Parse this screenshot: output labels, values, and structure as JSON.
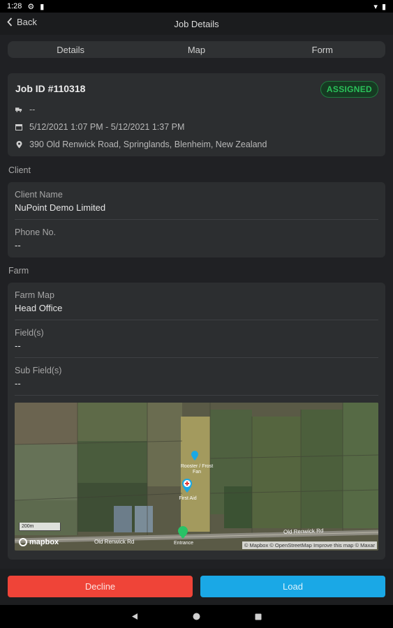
{
  "status_bar": {
    "time": "1:28"
  },
  "header": {
    "back_label": "Back",
    "title": "Job Details"
  },
  "tabs": [
    {
      "label": "Details"
    },
    {
      "label": "Map"
    },
    {
      "label": "Form"
    }
  ],
  "job": {
    "title": "Job ID #110318",
    "status": "ASSIGNED",
    "vehicle": "--",
    "datetime": "5/12/2021 1:07 PM - 5/12/2021 1:37 PM",
    "address": "390 Old Renwick Road, Springlands, Blenheim, New Zealand"
  },
  "client": {
    "section_label": "Client",
    "name_label": "Client Name",
    "name_value": "NuPoint Demo Limited",
    "phone_label": "Phone No.",
    "phone_value": "--"
  },
  "farm": {
    "section_label": "Farm",
    "map_label": "Farm Map",
    "map_value": "Head Office",
    "fields_label": "Field(s)",
    "fields_value": "--",
    "subfields_label": "Sub Field(s)",
    "subfields_value": "--"
  },
  "map": {
    "road_label_left": "Old Renwick Rd",
    "road_label_right": "Old Renwick Rd",
    "marker_top_label": "Rooster / Frost Fan",
    "marker_mid_label": "First Aid",
    "marker_bottom_label": "Entrance",
    "scale_label": "200m",
    "logo_text": "mapbox",
    "attribution": "© Mapbox © OpenStreetMap Improve this map © Maxar"
  },
  "actions": {
    "decline_label": "Decline",
    "load_label": "Load"
  },
  "colors": {
    "assigned": "#2bc25a",
    "decline": "#ef4438",
    "load": "#1aa8e6"
  }
}
